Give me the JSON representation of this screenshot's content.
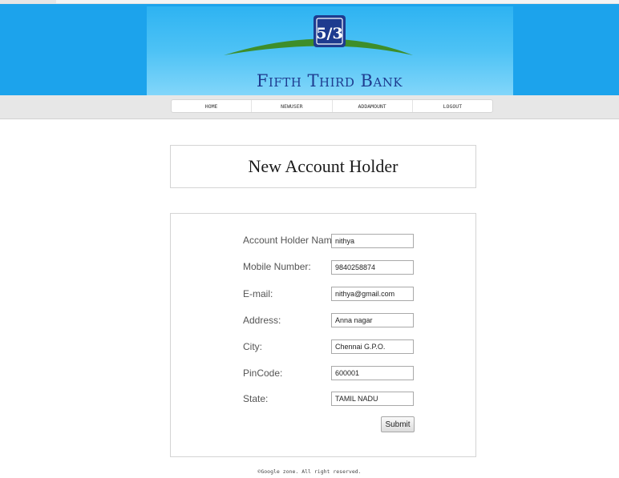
{
  "brand": {
    "name": "Fifth Third Bank",
    "logo_mark": "5/3",
    "colors": {
      "banner_blue": "#1ca3ec",
      "logo_navy": "#1e3b8f",
      "arc_green": "#3e8e2a"
    }
  },
  "nav": {
    "items": [
      {
        "label": "HOME"
      },
      {
        "label": "NEWUSER"
      },
      {
        "label": "ADDAMOUNT"
      },
      {
        "label": "LOGOUT"
      }
    ]
  },
  "page": {
    "title": "New Account Holder"
  },
  "form": {
    "fields": [
      {
        "label": "Account Holder Name:",
        "value": "nithya"
      },
      {
        "label": "Mobile Number:",
        "value": "9840258874"
      },
      {
        "label": "E-mail:",
        "value": "nithya@gmail.com"
      },
      {
        "label": "Address:",
        "value": "Anna nagar"
      },
      {
        "label": "City:",
        "value": "Chennai G.P.O."
      },
      {
        "label": "PinCode:",
        "value": "600001"
      },
      {
        "label": "State:",
        "value": "TAMIL NADU"
      }
    ],
    "submit_label": "Submit"
  },
  "footer": {
    "text": "©Google zone. All right reserved."
  }
}
